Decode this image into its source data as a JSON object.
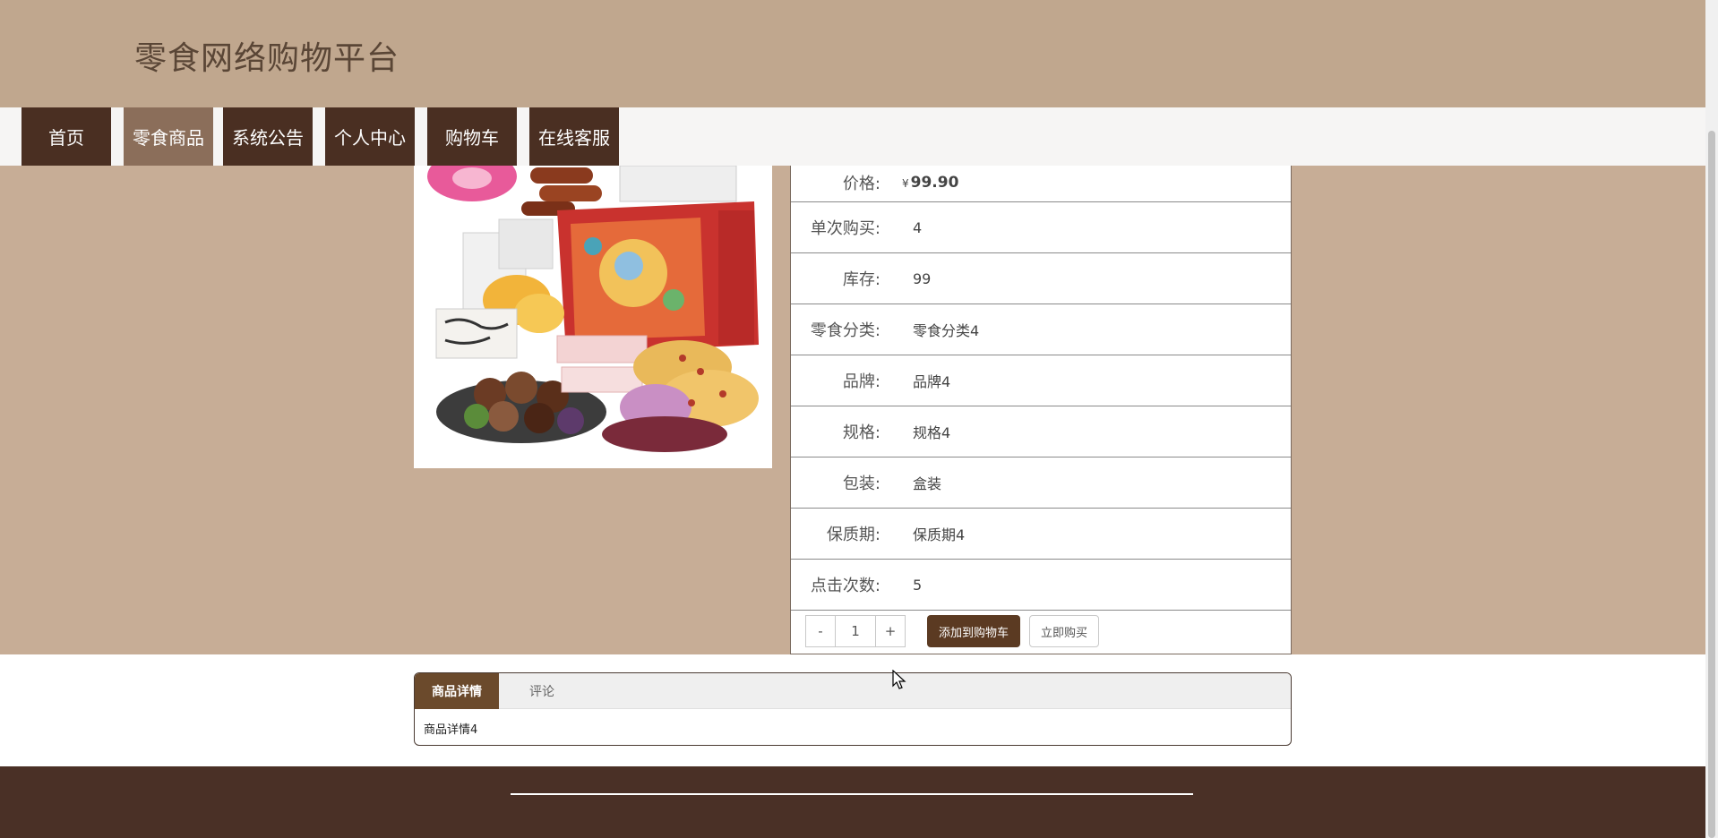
{
  "site": {
    "title": "零食网络购物平台"
  },
  "nav": {
    "items": [
      {
        "label": "首页"
      },
      {
        "label": "零食商品"
      },
      {
        "label": "系统公告"
      },
      {
        "label": "个人中心"
      },
      {
        "label": "购物车"
      },
      {
        "label": "在线客服"
      }
    ],
    "active_index": 1
  },
  "product": {
    "image_icon": "snack-gift-box-image",
    "price_label": "价格:",
    "price_currency": "¥",
    "price_value": "99.90",
    "rows": [
      {
        "label": "单次购买:",
        "value": "4"
      },
      {
        "label": "库存:",
        "value": "99"
      },
      {
        "label": "零食分类:",
        "value": "零食分类4"
      },
      {
        "label": "品牌:",
        "value": "品牌4"
      },
      {
        "label": "规格:",
        "value": "规格4"
      },
      {
        "label": "包装:",
        "value": "盒装"
      },
      {
        "label": "保质期:",
        "value": "保质期4"
      },
      {
        "label": "点击次数:",
        "value": "5"
      }
    ],
    "quantity": {
      "minus": "-",
      "value": "1",
      "plus": "+"
    },
    "add_to_cart_label": "添加到购物车",
    "buy_now_label": "立即购买"
  },
  "tabs": {
    "items": [
      {
        "label": "商品详情"
      },
      {
        "label": "评论"
      }
    ],
    "active_index": 0,
    "content": "商品详情4"
  },
  "colors": {
    "header_bg": "#c0a78e",
    "product_bg": "#c7ad96",
    "nav_item_bg": "#4a2f22",
    "nav_active_bg": "#8b6e5a",
    "accent_button": "#5b3a22",
    "footer_bg": "#4a3026"
  }
}
